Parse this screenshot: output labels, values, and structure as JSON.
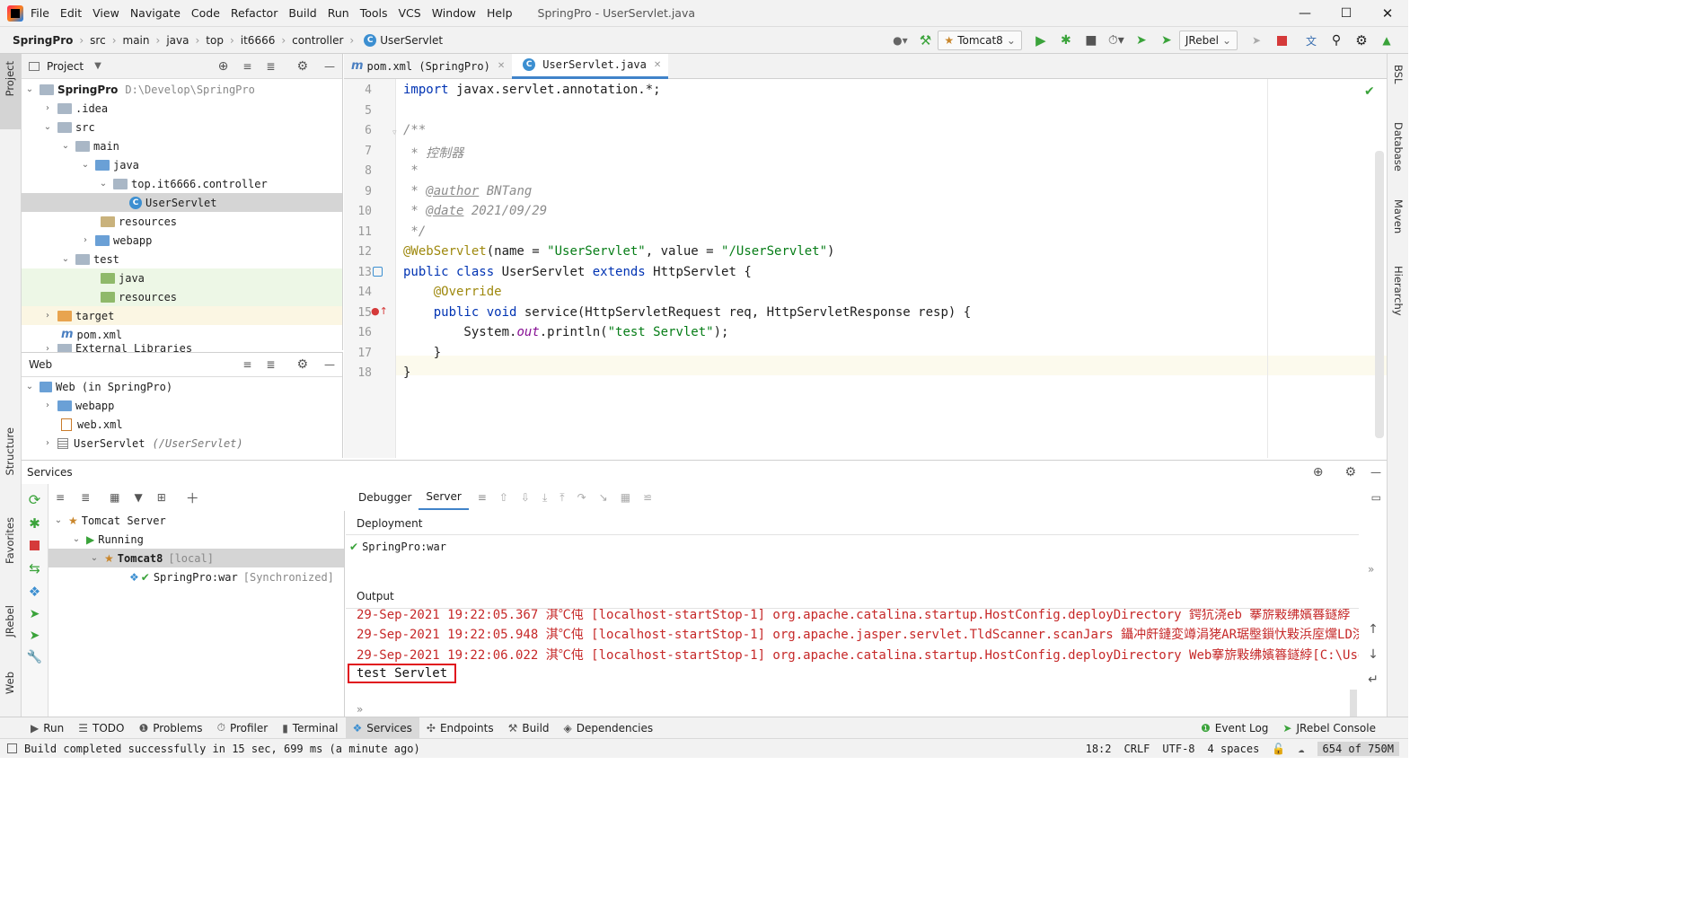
{
  "window": {
    "title": "SpringPro - UserServlet.java",
    "menu": [
      "File",
      "Edit",
      "View",
      "Navigate",
      "Code",
      "Refactor",
      "Build",
      "Run",
      "Tools",
      "VCS",
      "Window",
      "Help"
    ]
  },
  "breadcrumb": [
    "SpringPro",
    "src",
    "main",
    "java",
    "top",
    "it6666",
    "controller",
    "UserServlet"
  ],
  "toolbar": {
    "run_config": "Tomcat8",
    "jrebel": "JRebel"
  },
  "project": {
    "header": "Project",
    "root_name": "SpringPro",
    "root_path": "D:\\Develop\\SpringPro",
    "items": [
      ".idea",
      "src",
      "main",
      "java",
      "top.it6666.controller",
      "UserServlet",
      "resources",
      "webapp",
      "test",
      "java",
      "resources",
      "target",
      "pom.xml",
      "External Libraries"
    ]
  },
  "web": {
    "header": "Web",
    "root": "Web (in SpringPro)",
    "items": [
      "webapp",
      "web.xml",
      "UserServlet"
    ],
    "servlet_path": "(/UserServlet)"
  },
  "editor": {
    "tabs": [
      "pom.xml (SpringPro)",
      "UserServlet.java"
    ],
    "lines": {
      "l4a": "import",
      "l4b": " javax.servlet.annotation.*;",
      "l6": "/**",
      "l7": " * 控制器",
      "l8": " *",
      "l9a": " * ",
      "l9b": "@author",
      "l9c": " BNTang",
      "l10a": " * ",
      "l10b": "@date",
      "l10c": " 2021/09/29",
      "l11": " */",
      "l12a": "@WebServlet",
      "l12b": "(name = ",
      "l12c": "\"UserServlet\"",
      "l12d": ", value = ",
      "l12e": "\"/UserServlet\"",
      "l12f": ")",
      "l13a": "public class",
      "l13b": " UserServlet ",
      "l13c": "extends",
      "l13d": " HttpServlet {",
      "l14": "    @Override",
      "l15a": "    public void",
      "l15b": " service(HttpServletRequest req, HttpServletResponse resp) {",
      "l16a": "        System.",
      "l16b": "out",
      "l16c": ".println(",
      "l16d": "\"test Servlet\"",
      "l16e": ");",
      "l17": "    }",
      "l18": "}"
    },
    "line_numbers": [
      "4",
      "5",
      "6",
      "7",
      "8",
      "9",
      "10",
      "11",
      "12",
      "13",
      "14",
      "15",
      "16",
      "17",
      "18"
    ]
  },
  "services": {
    "header": "Services",
    "tree": {
      "server": "Tomcat Server",
      "running": "Running",
      "instance": "Tomcat8",
      "instance_tag": "[local]",
      "artifact": "SpringPro:war",
      "artifact_tag": "[Synchronized]"
    },
    "tabs": [
      "Debugger",
      "Server"
    ],
    "deployment_label": "Deployment",
    "deployment_item": "SpringPro:war",
    "output_label": "Output",
    "output_lines": [
      "29-Sep-2021 19:22:05.367 淇℃伅 [localhost-startStop-1] org.apache.catalina.startup.HostConfig.deployDirectory 鍔犺浇eb 搴旂敤绋嬪簭鐩綍 [",
      "29-Sep-2021 19:22:05.948 淇℃伅 [localhost-startStop-1] org.apache.jasper.servlet.TldScanner.scanJars 鑷冲皯鏈変竴涓狫AR琚壂鎻忕敤浜庢爣LD浣嗘湭鍖",
      "29-Sep-2021 19:22:06.022 淇℃伅 [localhost-startStop-1] org.apache.catalina.startup.HostConfig.deployDirectory Web搴旂敤绋嬪簭鐩綍[C:\\Users\\B"
    ],
    "highlight": "test Servlet"
  },
  "toolwindows": [
    "Run",
    "TODO",
    "Problems",
    "Profiler",
    "Terminal",
    "Services",
    "Endpoints",
    "Build",
    "Dependencies"
  ],
  "toolwindows_right": [
    "Event Log",
    "JRebel Console"
  ],
  "left_strip": [
    "Project",
    "Structure",
    "Favorites",
    "JRebel",
    "Web"
  ],
  "right_strip": [
    "BSL",
    "Database",
    "Maven",
    "Hierarchy"
  ],
  "status": {
    "message": "Build completed successfully in 15 sec, 699 ms (a minute ago)",
    "position": "18:2",
    "line_sep": "CRLF",
    "encoding": "UTF-8",
    "indent": "4 spaces",
    "memory": "654 of 750M"
  },
  "colors": {
    "accent": "#4083c9",
    "highlight_box": "#e0141e",
    "run_green": "#3aa33a",
    "stop_red": "#d53a3a"
  }
}
